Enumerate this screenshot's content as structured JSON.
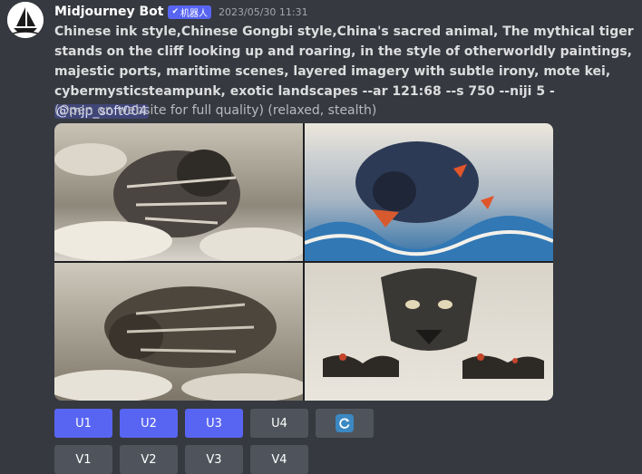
{
  "message": {
    "author": "Midjourney Bot",
    "bot_badge": "机器人",
    "timestamp": "2023/05/30 11:31",
    "prompt_text": "Chinese ink style,Chinese Gongbi style,China's sacred animal, The mythical tiger stands on the cliff looking up and roaring, in the style of otherworldly paintings, majestic ports, maritime scenes, layered imagery with subtle irony, mote kei, cybermysticsteampunk, exotic landscapes --ar 121:68 --s 750 --niji 5 - ",
    "mention": "@mjp_soft004",
    "note": "(Open on website for full quality) (relaxed, stealth)"
  },
  "image": {
    "icon": "generated-image-grid",
    "tiles": [
      "tiger-ink-wash-tile-1",
      "tiger-blue-waves-tile-2",
      "tiger-crouching-tile-3",
      "tiger-face-front-tile-4"
    ]
  },
  "buttons": {
    "upscale": [
      "U1",
      "U2",
      "U3",
      "U4"
    ],
    "variation": [
      "V1",
      "V2",
      "V3",
      "V4"
    ],
    "reroll_icon": "refresh-icon"
  },
  "colors": {
    "background": "#36393f",
    "blurple": "#5865f2",
    "secondary": "#4f545c",
    "mention_bg": "#414675",
    "reroll_glyph": "#3b88c3"
  }
}
